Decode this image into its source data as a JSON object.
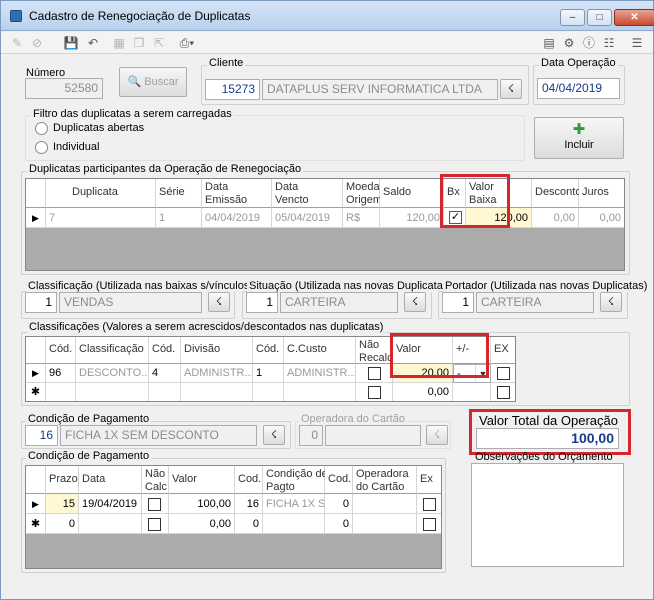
{
  "window": {
    "title": "Cadastro de Renegociação de Duplicatas"
  },
  "header": {
    "numero_label": "Número",
    "numero_value": "52580",
    "buscar_label": "Buscar",
    "cliente_label": "Cliente",
    "cliente_code": "15273",
    "cliente_name": "DATAPLUS SERV INFORMATICA LTDA",
    "data_operacao_label": "Data Operação",
    "data_operacao_value": "04/04/2019"
  },
  "filtro": {
    "title": "Filtro das duplicatas a serem carregadas",
    "opt1": "Duplicatas abertas",
    "opt2": "Individual"
  },
  "incluir_label": "Incluir",
  "duplicatas": {
    "title": "Duplicatas participantes da Operação de Renegociação",
    "headers": [
      "Duplicata",
      "Série",
      "Data\nEmissão",
      "Data\nVencto",
      "Moeda\nOrigem",
      "Saldo",
      "Bx",
      "Valor\nBaixa",
      "Desconto",
      "Juros"
    ],
    "row": {
      "duplicata": "7",
      "serie": "1",
      "emissao": "04/04/2019",
      "vencto": "05/04/2019",
      "moeda": "R$",
      "saldo": "120,00",
      "valor_baixa": "120,00",
      "desconto": "0,00",
      "juros": "0,00"
    }
  },
  "classificacao": {
    "label": "Classificação (Utilizada nas baixas s/vínculos)",
    "code": "1",
    "name": "VENDAS"
  },
  "situacao": {
    "label": "Situação (Utilizada nas novas Duplicatas)",
    "code": "1",
    "name": "CARTEIRA"
  },
  "portador": {
    "label": "Portador (Utilizada nas novas Duplicatas)",
    "code": "1",
    "name": "CARTEIRA"
  },
  "classificacoes": {
    "title": "Classificações (Valores a serem acrescidos/descontados nas duplicatas)",
    "headers": [
      "Cód.",
      "Classificação",
      "Cód.",
      "Divisão",
      "Cód.",
      "C.Custo",
      "Não\nRecalc",
      "Valor",
      "+/-",
      "EX"
    ],
    "row1": {
      "cod": "96",
      "classif": "DESCONTO...",
      "cod2": "4",
      "divisao": "ADMINISTR...",
      "cod3": "1",
      "ccusto": "ADMINISTR...",
      "valor": "20,00",
      "sign": "-"
    },
    "row2": {
      "valor": "0,00"
    }
  },
  "condicao": {
    "label": "Condição de Pagamento",
    "code": "16",
    "name": "FICHA 1X SEM DESCONTO"
  },
  "operadora": {
    "label": "Operadora do Cartão",
    "code": "0"
  },
  "valor_total": {
    "label": "Valor Total da Operação",
    "value": "100,00"
  },
  "observacoes": {
    "label": "Observações do Orçamento"
  },
  "parcelas": {
    "title": "Condição de Pagamento",
    "headers": [
      "Prazo",
      "Data",
      "Não\nCalc",
      "Valor",
      "Cod.",
      "Condição de\nPagto",
      "Cod.",
      "Operadora\ndo Cartão",
      "Ex"
    ],
    "row1": {
      "prazo": "15",
      "data": "19/04/2019",
      "valor": "100,00",
      "cod": "16",
      "cond": "FICHA 1X S...",
      "cod2": "0"
    },
    "row2": {
      "prazo": "0",
      "valor": "0,00",
      "cod": "0",
      "cod2": "0"
    }
  },
  "colors": {
    "highlight": "#d6262d",
    "accent_blue": "#1a3a8e"
  }
}
